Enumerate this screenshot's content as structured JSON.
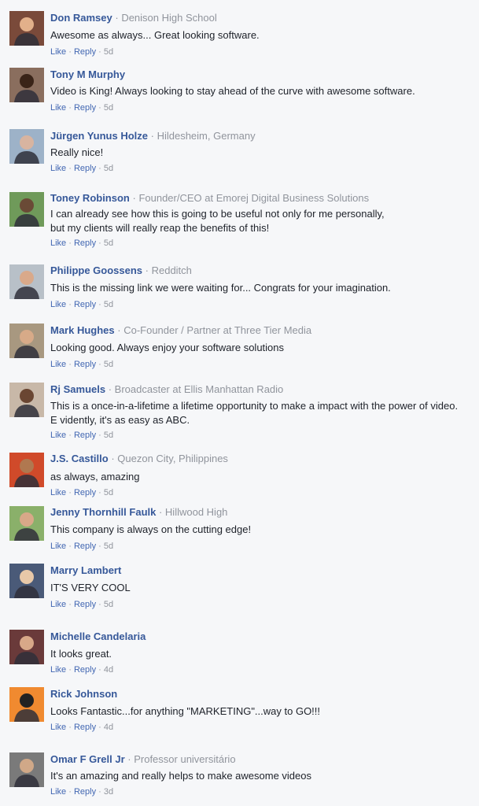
{
  "comments": [
    {
      "name": "Don Ramsey",
      "meta": "Denison High School",
      "text": [
        "Awesome as always... Great looking software."
      ],
      "like": "Like",
      "reply": "Reply",
      "age": "5d",
      "avatar": {
        "bg": "#7a4a3a",
        "fg": "#e2b08a"
      }
    },
    {
      "name": "Tony M Murphy",
      "meta": "",
      "text": [
        "Video is King! Always looking to stay ahead of the curve with awesome software."
      ],
      "like": "Like",
      "reply": "Reply",
      "age": "5d",
      "avatar": {
        "bg": "#8a6e5e",
        "fg": "#3a2418"
      }
    },
    {
      "name": "Jürgen Yunus Holze",
      "meta": "Hildesheim, Germany",
      "text": [
        "Really nice!"
      ],
      "like": "Like",
      "reply": "Reply",
      "age": "5d",
      "avatar": {
        "bg": "#9db2c8",
        "fg": "#d8b4a0"
      }
    },
    {
      "name": "Toney Robinson",
      "meta": "Founder/CEO at Emorej Digital Business Solutions",
      "text": [
        "I can already see how this is going to be useful not only for me personally,",
        "but my clients will really reap the benefits of this!"
      ],
      "like": "Like",
      "reply": "Reply",
      "age": "5d",
      "avatar": {
        "bg": "#6f9a5a",
        "fg": "#6a4a36"
      }
    },
    {
      "name": "Philippe Goossens",
      "meta": "Redditch",
      "text": [
        "This is the missing link we were waiting for... Congrats for your imagination."
      ],
      "like": "Like",
      "reply": "Reply",
      "age": "5d",
      "avatar": {
        "bg": "#b8c0c8",
        "fg": "#d9a98a"
      }
    },
    {
      "name": "Mark Hughes",
      "meta": "Co-Founder / Partner at Three Tier Media",
      "text": [
        "Looking good. Always enjoy your software solutions"
      ],
      "like": "Like",
      "reply": "Reply",
      "age": "5d",
      "avatar": {
        "bg": "#a89880",
        "fg": "#d7aa88"
      }
    },
    {
      "name": "Rj Samuels",
      "meta": "Broadcaster at Ellis Manhattan Radio",
      "text": [
        "This is a once-in-a-lifetime a lifetime opportunity to make a impact with the power of video.",
        "E vidently, it's as easy as  ABC."
      ],
      "like": "Like",
      "reply": "Reply",
      "age": "5d",
      "avatar": {
        "bg": "#c8b8a8",
        "fg": "#6a4632"
      }
    },
    {
      "name": "J.S. Castillo",
      "meta": "Quezon City, Philippines",
      "text": [
        "as always, amazing"
      ],
      "like": "Like",
      "reply": "Reply",
      "age": "5d",
      "avatar": {
        "bg": "#d04a2a",
        "fg": "#b07850"
      }
    },
    {
      "name": "Jenny Thornhill Faulk",
      "meta": "Hillwood High",
      "text": [
        "This company is always on the cutting edge!"
      ],
      "like": "Like",
      "reply": "Reply",
      "age": "5d",
      "avatar": {
        "bg": "#8ab06a",
        "fg": "#d8a888"
      }
    },
    {
      "name": "Marry Lambert",
      "meta": "",
      "text": [
        "IT'S VERY COOL"
      ],
      "like": "Like",
      "reply": "Reply",
      "age": "5d",
      "avatar": {
        "bg": "#4a5a78",
        "fg": "#e8c8a8"
      }
    },
    {
      "name": "Michelle Candelaria",
      "meta": "",
      "text": [
        "It looks great."
      ],
      "like": "Like",
      "reply": "Reply",
      "age": "4d",
      "avatar": {
        "bg": "#6a3a3a",
        "fg": "#d8a888"
      }
    },
    {
      "name": "Rick Johnson",
      "meta": "",
      "text": [
        "Looks Fantastic...for anything \"MARKETING\"...way to GO!!!"
      ],
      "like": "Like",
      "reply": "Reply",
      "age": "4d",
      "avatar": {
        "bg": "#f08a30",
        "fg": "#222222"
      }
    },
    {
      "name": "Omar F Grell Jr",
      "meta": "Professor universitário",
      "text": [
        "It's an amazing and really helps to make awesome videos"
      ],
      "like": "Like",
      "reply": "Reply",
      "age": "3d",
      "avatar": {
        "bg": "#7a7a7a",
        "fg": "#d0a888"
      }
    }
  ]
}
